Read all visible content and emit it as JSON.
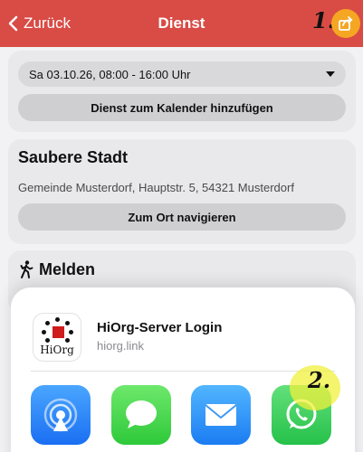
{
  "header": {
    "back_label": "Zurück",
    "title": "Dienst",
    "bg_color": "#d94b45",
    "share_icon": "share-icon",
    "share_color": "#f5a623"
  },
  "annotations": {
    "step1": "1.",
    "step2": "2."
  },
  "shift": {
    "selected": "Sa 03.10.26, 08:00 - 16:00 Uhr",
    "calendar_button": "Dienst zum Kalender hinzufügen"
  },
  "location": {
    "title": "Saubere Stadt",
    "address": "Gemeinde Musterdorf, Hauptstr. 5, 54321 Musterdorf",
    "navigate_button": "Zum Ort navigieren"
  },
  "report": {
    "icon": "hiking-person-icon",
    "title": "Melden"
  },
  "share_sheet": {
    "app_name": "HiOrg-Server Login",
    "app_url": "hiorg.link",
    "logo_text": "HiOrg",
    "apps": [
      {
        "name": "AirDrop",
        "icon": "airdrop-icon"
      },
      {
        "name": "Nachrichten",
        "icon": "messages-icon"
      },
      {
        "name": "Mail",
        "icon": "mail-icon"
      },
      {
        "name": "WhatsApp",
        "icon": "whatsapp-icon"
      }
    ]
  }
}
